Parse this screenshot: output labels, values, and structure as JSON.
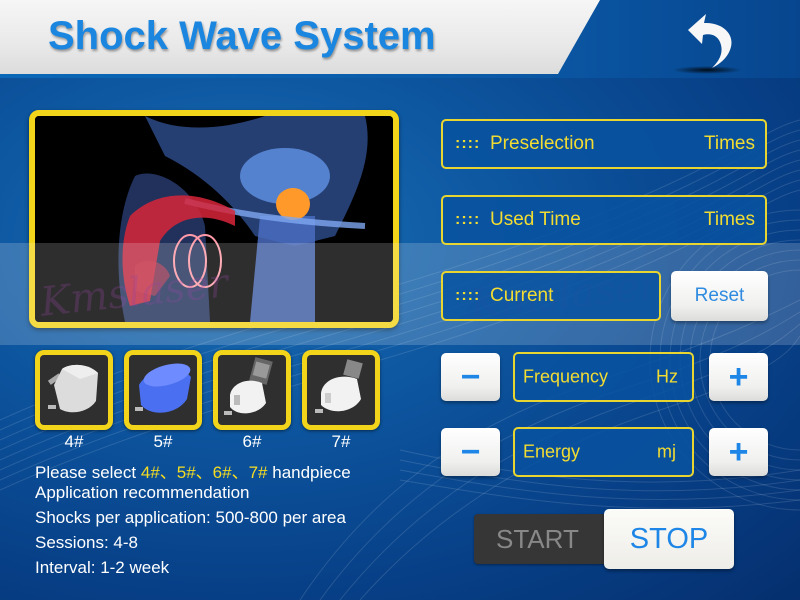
{
  "header": {
    "title": "Shock Wave System",
    "back_icon": "back-arrow-icon"
  },
  "image_panel": {
    "description": "Male pelvic anatomy illustration",
    "watermark": "Kmslaser"
  },
  "handpieces": [
    {
      "label": "4#",
      "color": "#d8d8d8",
      "selected": true
    },
    {
      "label": "5#",
      "color": "#4a6ff0",
      "selected": true
    },
    {
      "label": "6#",
      "color": "#f2f2f2",
      "selected": true
    },
    {
      "label": "7#",
      "color": "#f2f2f2",
      "selected": true
    }
  ],
  "info": {
    "select_prefix": "Please select",
    "select_items": "4#、5#、6#、7#",
    "select_suffix": "handpiece",
    "lines": [
      "Application recommendation",
      "Shocks per application: 500-800 per area",
      "Sessions: 4-8",
      "Interval: 1-2 week"
    ]
  },
  "fields": {
    "preselection": {
      "dots": "::::",
      "label": "Preselection",
      "unit": "Times"
    },
    "used_time": {
      "dots": "::::",
      "label": "Used Time",
      "unit": "Times"
    },
    "current": {
      "dots": "::::",
      "label": "Current"
    },
    "frequency": {
      "label": "Frequency",
      "unit": "Hz"
    },
    "energy": {
      "label": "Energy",
      "unit": "mj"
    }
  },
  "buttons": {
    "reset": "Reset",
    "minus": "−",
    "plus": "+",
    "start": "START",
    "stop": "STOP"
  },
  "colors": {
    "accent_yellow": "#f2d41a",
    "title_blue": "#1a86e0",
    "background_blue": "#0b4f9a"
  }
}
